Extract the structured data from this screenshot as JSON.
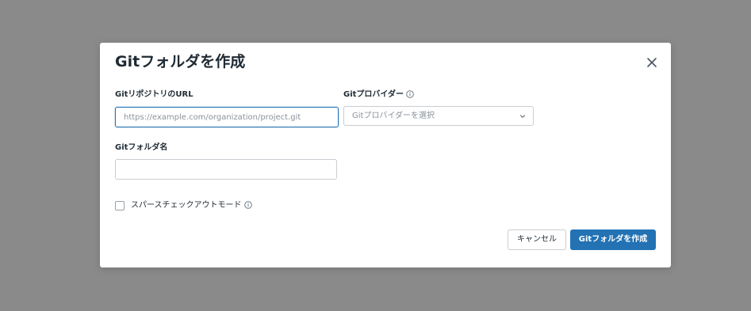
{
  "dialog": {
    "title": "Gitフォルダを作成",
    "close_icon": "close-icon"
  },
  "repo_url": {
    "label": "GitリポジトリのURL",
    "placeholder": "https://example.com/organization/project.git",
    "value": ""
  },
  "git_provider": {
    "label": "Gitプロバイダー",
    "info_icon": "info-icon",
    "placeholder": "Gitプロバイダーを選択",
    "chevron_icon": "chevron-down-icon"
  },
  "folder_name": {
    "label": "Gitフォルダ名",
    "value": ""
  },
  "sparse_checkout": {
    "label": "スパースチェックアウトモード",
    "checked": false,
    "info_icon": "info-icon"
  },
  "actions": {
    "cancel_label": "キャンセル",
    "create_label": "Gitフォルダを作成"
  },
  "colors": {
    "overlay": "#8a8a8a",
    "primary": "#2272b4",
    "text": "#1f2a33",
    "border": "#c9ced3"
  }
}
